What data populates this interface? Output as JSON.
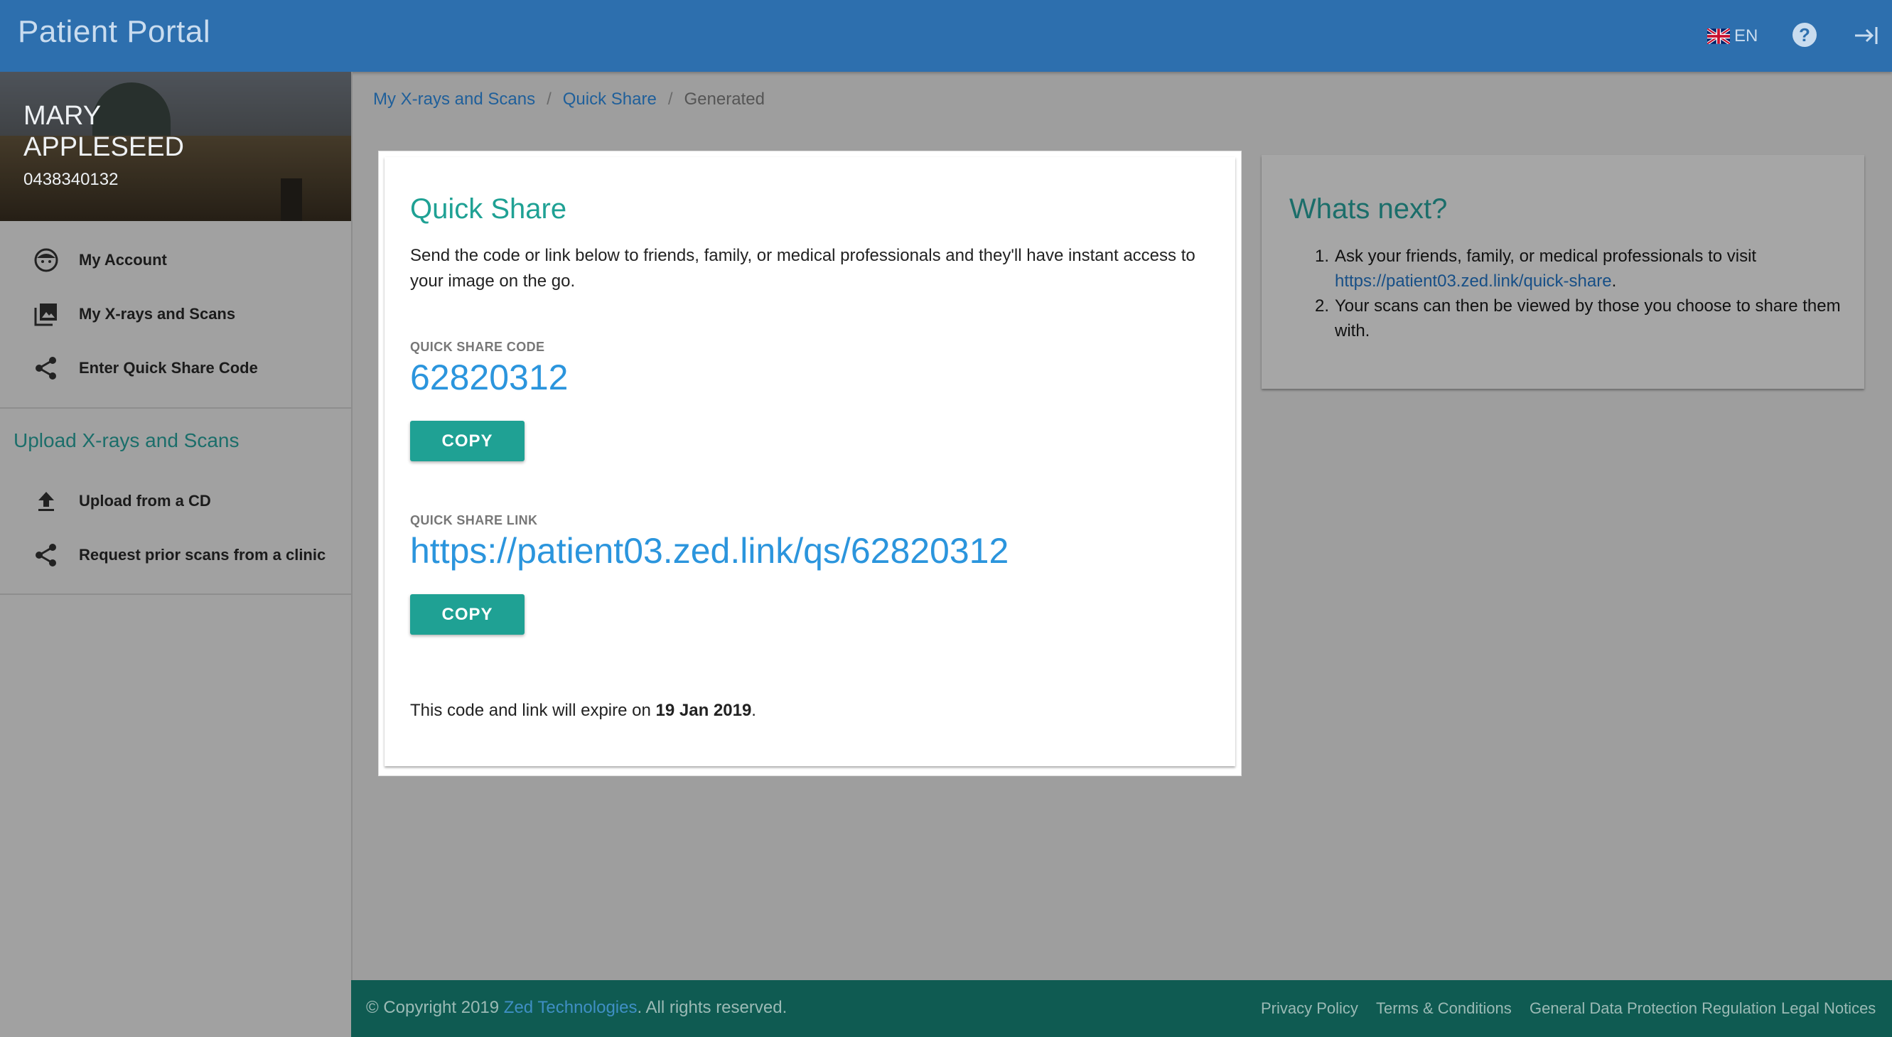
{
  "header": {
    "app_title": "Patient Portal",
    "language": "EN",
    "help_symbol": "?",
    "icons": {
      "flag": "uk-flag-icon",
      "help": "help-circle-icon",
      "logout": "logout-arrow-icon"
    }
  },
  "profile": {
    "name": "MARY APPLESEED",
    "phone": "0438340132"
  },
  "sidebar": {
    "items": [
      {
        "label": "My Account",
        "icon": "face-icon"
      },
      {
        "label": "My X-rays and Scans",
        "icon": "images-icon"
      },
      {
        "label": "Enter Quick Share Code",
        "icon": "share-icon"
      }
    ],
    "upload_heading": "Upload X-rays and Scans",
    "upload_items": [
      {
        "label": "Upload from a CD",
        "icon": "upload-icon"
      },
      {
        "label": "Request prior scans from a clinic",
        "icon": "share-icon"
      }
    ]
  },
  "breadcrumb": {
    "items": [
      "My X-rays and Scans",
      "Quick Share",
      "Generated"
    ],
    "separator": "/"
  },
  "quick_share": {
    "title": "Quick Share",
    "description": "Send the code or link below to friends, family, or medical professionals and they'll have instant access to your image on the go.",
    "code_label": "QUICK SHARE CODE",
    "code": "62820312",
    "copy_label": "COPY",
    "link_label": "QUICK SHARE LINK",
    "link": "https://patient03.zed.link/qs/62820312",
    "expiry_prefix": "This code and link will expire on ",
    "expiry_date": "19 Jan 2019",
    "expiry_suffix": "."
  },
  "whats_next": {
    "title": "Whats next?",
    "step1_num": "1.",
    "step1_text": "Ask your friends, family, or medical professionals to visit",
    "step1_link": "https://patient03.zed.link/quick-share",
    "step1_end": ".",
    "step2_num": "2.",
    "step2_text": "Your scans can then be viewed by those you choose to share them with."
  },
  "footer": {
    "copyright_prefix": "© Copyright 2019 ",
    "company": "Zed Technologies",
    "copyright_suffix": ". All rights reserved.",
    "links": [
      "Privacy Policy",
      "Terms & Conditions",
      "General Data Protection Regulation",
      "Legal Notices"
    ]
  },
  "colors": {
    "header_bg": "#2d6fae",
    "accent_teal": "#1fa194",
    "link_blue": "#2b95dd",
    "footer_bg": "#0f5b52"
  }
}
